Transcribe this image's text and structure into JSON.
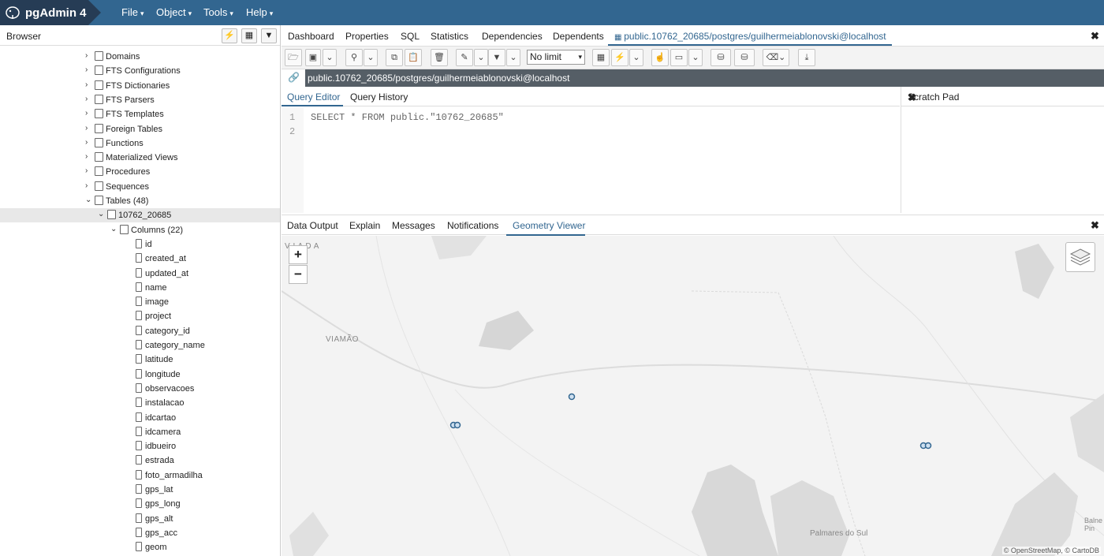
{
  "app": {
    "title": "pgAdmin 4"
  },
  "menu": [
    {
      "label": "File"
    },
    {
      "label": "Object"
    },
    {
      "label": "Tools"
    },
    {
      "label": "Help"
    }
  ],
  "browser": {
    "title": "Browser",
    "tree": [
      {
        "label": "Domains"
      },
      {
        "label": "FTS Configurations"
      },
      {
        "label": "FTS Dictionaries"
      },
      {
        "label": "FTS Parsers"
      },
      {
        "label": "FTS Templates"
      },
      {
        "label": "Foreign Tables"
      },
      {
        "label": "Functions"
      },
      {
        "label": "Materialized Views"
      },
      {
        "label": "Procedures"
      },
      {
        "label": "Sequences"
      },
      {
        "label": "Tables (48)"
      },
      {
        "label": "10762_20685"
      },
      {
        "label": "Columns (22)"
      }
    ],
    "columns": [
      "id",
      "created_at",
      "updated_at",
      "name",
      "image",
      "project",
      "category_id",
      "category_name",
      "latitude",
      "longitude",
      "observacoes",
      "instalacao",
      "idcartao",
      "idcamera",
      "idbueiro",
      "estrada",
      "foto_armadilha",
      "gps_lat",
      "gps_long",
      "gps_alt",
      "gps_acc",
      "geom"
    ]
  },
  "tabs": [
    {
      "label": "Dashboard"
    },
    {
      "label": "Properties"
    },
    {
      "label": "SQL"
    },
    {
      "label": "Statistics"
    },
    {
      "label": "Dependencies"
    },
    {
      "label": "Dependents"
    },
    {
      "label": "public.10762_20685/postgres/guilhermeiablonovski@localhost"
    }
  ],
  "toolbar": {
    "limit_value": "No limit"
  },
  "connection": {
    "label": "public.10762_20685/postgres/guilhermeiablonovski@localhost"
  },
  "query_tabs": [
    {
      "label": "Query Editor"
    },
    {
      "label": "Query History"
    }
  ],
  "editor": {
    "lines": [
      {
        "num": "1",
        "code": "SELECT * FROM public.\"10762_20685\""
      },
      {
        "num": "2",
        "code": ""
      }
    ]
  },
  "scratch": {
    "title": "Scratch Pad"
  },
  "output_tabs": [
    {
      "label": "Data Output"
    },
    {
      "label": "Explain"
    },
    {
      "label": "Messages"
    },
    {
      "label": "Notifications"
    },
    {
      "label": "Geometry Viewer"
    }
  ],
  "map": {
    "labels": {
      "viamao": "VIAMÃO",
      "top_left": "V I A D A",
      "palmares": "Palmares do Sul",
      "balneario": "Balne Pin"
    },
    "zoom_in": "+",
    "zoom_out": "−",
    "attribution": "© OpenStreetMap, © CartoDB"
  },
  "colors": {
    "header": "#326690",
    "brand": "#263c55",
    "accent": "#326690",
    "marker": "#326690"
  }
}
